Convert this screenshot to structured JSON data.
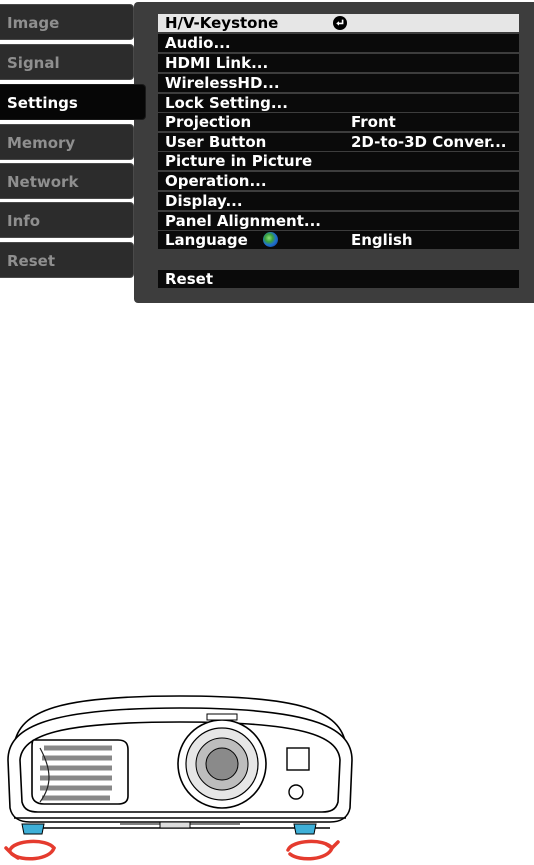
{
  "sidebar": {
    "tabs": [
      {
        "label": "Image"
      },
      {
        "label": "Signal"
      },
      {
        "label": "Settings"
      },
      {
        "label": "Memory"
      },
      {
        "label": "Network"
      },
      {
        "label": "Info"
      },
      {
        "label": "Reset"
      }
    ],
    "active_tab": "Settings"
  },
  "settings_menu": {
    "items": [
      {
        "label": "H/V-Keystone",
        "icon": "enter-icon"
      },
      {
        "label": "Audio..."
      },
      {
        "label": "HDMI Link..."
      },
      {
        "label": "WirelessHD..."
      },
      {
        "label": "Lock Setting..."
      },
      {
        "label": "Projection",
        "value": "Front"
      },
      {
        "label": "User Button",
        "value": "2D-to-3D Conver..."
      },
      {
        "label": "Picture in Picture"
      },
      {
        "label": "Operation..."
      },
      {
        "label": "Display..."
      },
      {
        "label": "Panel Alignment..."
      },
      {
        "label": "Language",
        "value": "English",
        "icon": "globe-icon"
      }
    ],
    "reset_label": "Reset"
  },
  "colors": {
    "highlight": "#e6e6e6",
    "row": "#0a0a0a",
    "panel": "#3d3d3d",
    "tab_inactive_text": "#8f8f8f",
    "foot_accent": "#3fb0d8",
    "arrow": "#e53b2e"
  },
  "illustration": {
    "subject": "projector-front-view",
    "icons": [
      "rotate-arrow-icon",
      "rotate-arrow-icon"
    ]
  }
}
